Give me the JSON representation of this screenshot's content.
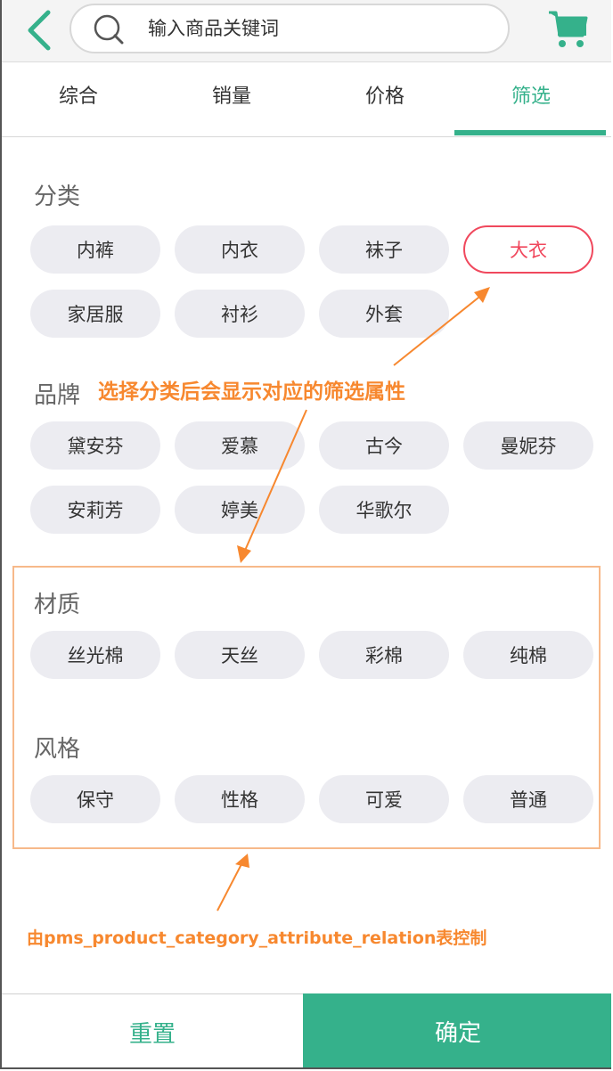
{
  "search": {
    "placeholder": "输入商品关键词"
  },
  "tabs": [
    {
      "label": "综合"
    },
    {
      "label": "销量"
    },
    {
      "label": "价格"
    },
    {
      "label": "筛选"
    }
  ],
  "filters": {
    "category": {
      "title": "分类",
      "options": [
        "内裤",
        "内衣",
        "袜子",
        "大衣",
        "家居服",
        "衬衫",
        "外套"
      ],
      "selected": "大衣"
    },
    "brand": {
      "title": "品牌",
      "options": [
        "黛安芬",
        "爱慕",
        "古今",
        "曼妮芬",
        "安莉芳",
        "婷美",
        "华歌尔"
      ]
    },
    "material": {
      "title": "材质",
      "options": [
        "丝光棉",
        "天丝",
        "彩棉",
        "纯棉"
      ]
    },
    "style": {
      "title": "风格",
      "options": [
        "保守",
        "性格",
        "可爱",
        "普通"
      ]
    }
  },
  "annotations": {
    "note1": "选择分类后会显示对应的筛选属性",
    "note2": "由pms_product_category_attribute_relation表控制"
  },
  "footer": {
    "reset_label": "重置",
    "confirm_label": "确定"
  },
  "colors": {
    "accent": "#35b18b",
    "selected": "#f0485d",
    "annotation": "#f7882f",
    "chip_bg": "#ececf1"
  },
  "icons": {
    "back": "chevron-left-icon",
    "search": "search-icon",
    "cart": "cart-icon"
  }
}
